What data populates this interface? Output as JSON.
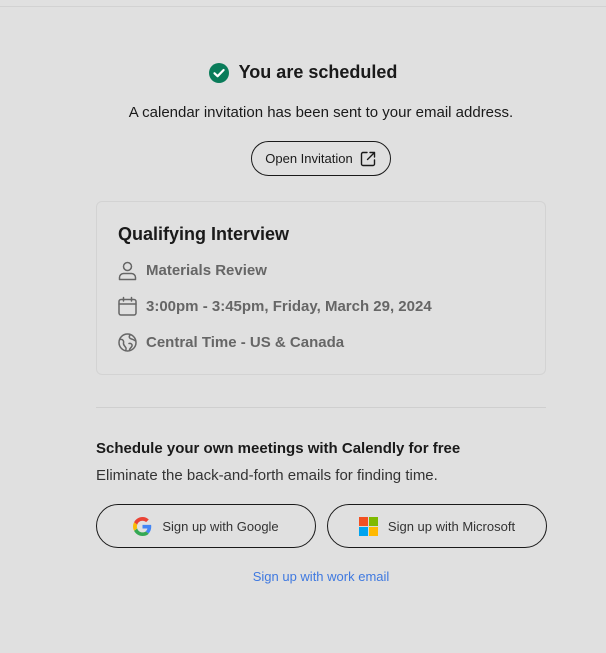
{
  "confirmation": {
    "title": "You are scheduled",
    "subtitle": "A calendar invitation has been sent to your email address.",
    "open_invitation_label": "Open Invitation",
    "status_color": "#0a7c5a"
  },
  "event": {
    "name": "Qualifying Interview",
    "host": "Materials Review",
    "datetime": "3:00pm - 3:45pm, Friday, March 29, 2024",
    "timezone": "Central Time - US & Canada"
  },
  "promo": {
    "title": "Schedule your own meetings with Calendly for free",
    "text": "Eliminate the back-and-forth emails for finding time.",
    "google_label": "Sign up with Google",
    "microsoft_label": "Sign up with Microsoft",
    "work_email_label": "Sign up with work email",
    "link_color": "#3f79e0"
  },
  "icons": {
    "status": "check-circle-icon",
    "open": "external-link-icon",
    "host": "person-icon",
    "date": "calendar-icon",
    "timezone": "globe-icon",
    "google": "google-icon",
    "microsoft": "microsoft-icon"
  }
}
